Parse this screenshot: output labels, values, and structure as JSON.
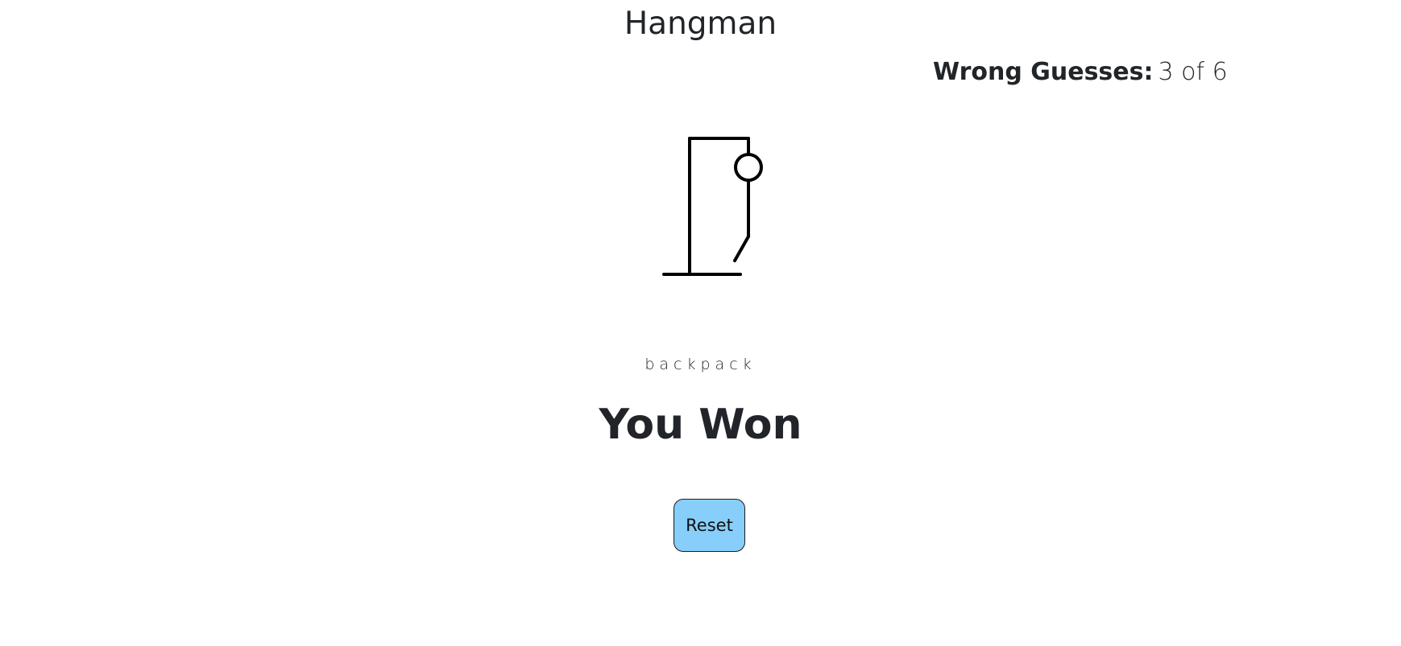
{
  "app": {
    "title": "Hangman"
  },
  "status": {
    "wrong_guesses_label": "Wrong Guesses:",
    "wrong_guesses_value": "3 of 6",
    "wrong_count": 3,
    "max_wrong": 6
  },
  "word": {
    "display": "backpack"
  },
  "result": {
    "message": "You Won"
  },
  "controls": {
    "reset_label": "Reset"
  },
  "colors": {
    "text": "#212529",
    "button_background": "#87cefa",
    "drawing_stroke": "#000000"
  },
  "drawing": {
    "parts_visible": [
      "head",
      "body",
      "left-leg"
    ]
  }
}
